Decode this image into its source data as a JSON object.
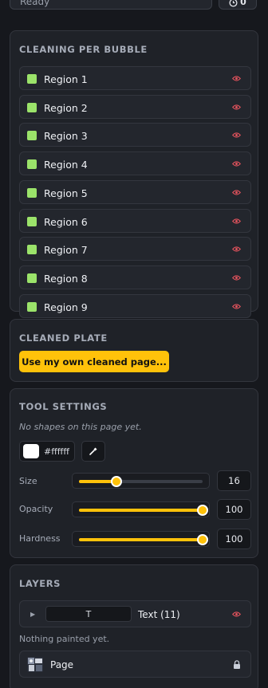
{
  "topbar": {
    "status": "Ready",
    "counter": "0"
  },
  "cleaning": {
    "title": "CLEANING PER BUBBLE",
    "regions": [
      "Region 1",
      "Region 2",
      "Region 3",
      "Region 4",
      "Region 5",
      "Region 6",
      "Region 7",
      "Region 8",
      "Region 9"
    ]
  },
  "plate": {
    "title": "CLEANED PLATE",
    "button": "Use my own cleaned page..."
  },
  "tool": {
    "title": "TOOL SETTINGS",
    "empty": "No shapes on this page yet.",
    "color_hex": "#ffffff",
    "sliders": [
      {
        "label": "Size",
        "value": "16",
        "fraction": 0.3
      },
      {
        "label": "Opacity",
        "value": "100",
        "fraction": 1.0
      },
      {
        "label": "Hardness",
        "value": "100",
        "fraction": 1.0
      }
    ]
  },
  "layers": {
    "title": "LAYERS",
    "text_preview": "T",
    "text_layer": "Text (11)",
    "empty": "Nothing painted yet.",
    "page_layer": "Page"
  },
  "colors": {
    "accent": "#ffc20a",
    "swatch": "#9be36a",
    "eye": "#e0525c"
  }
}
